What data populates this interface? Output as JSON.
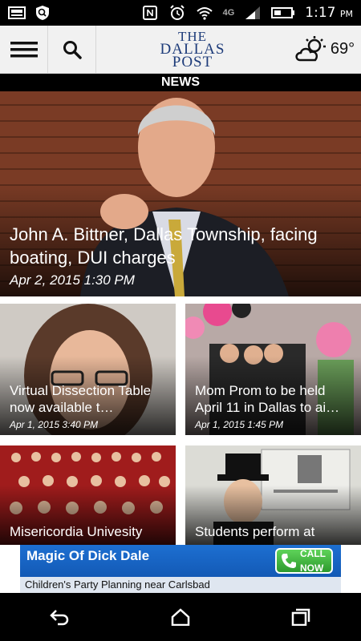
{
  "status": {
    "time": "1:17",
    "ampm": "PM",
    "network": "4G",
    "icons": [
      "gallery-icon",
      "shield-icon",
      "nfc-icon",
      "alarm-icon",
      "wifi-icon",
      "signal-icon",
      "battery-icon"
    ]
  },
  "header": {
    "menu_icon": "hamburger-menu-icon",
    "search_icon": "search-icon",
    "logo_line1": "THE",
    "logo_line2": "DALLAS",
    "logo_line3": "POST",
    "weather_icon": "partly-cloudy-icon",
    "temperature": "69°"
  },
  "section_title": "NEWS",
  "hero": {
    "title": "John A. Bittner, Dallas Township, facing boating, DUI charges",
    "date": "Apr 2, 2015 1:30 PM"
  },
  "articles": [
    {
      "title": "Virtual Dissection Table now available t…",
      "date": "Apr 1, 2015 3:40 PM"
    },
    {
      "title": "Mom Prom to be held April 11 in Dallas to ai…",
      "date": "Apr 1, 2015 1:45 PM"
    },
    {
      "title": "Misericordia Univesity",
      "date": ""
    },
    {
      "title": "Students perform at",
      "date": ""
    }
  ],
  "ad": {
    "title": "Magic Of Dick Dale",
    "subtitle": "Children's Party Planning near Carlsbad",
    "call_line1": "CALL",
    "call_line2": "NOW"
  },
  "navbar": {
    "icons": [
      "back-icon",
      "home-icon",
      "recent-apps-icon"
    ]
  }
}
